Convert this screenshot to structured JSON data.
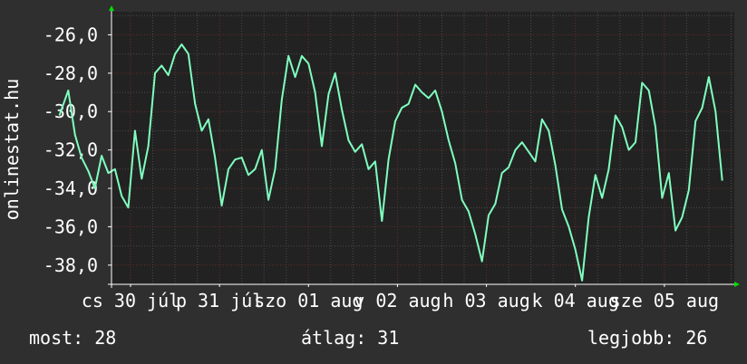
{
  "chart_data": {
    "type": "line",
    "watermark": "onlinestat.hu",
    "ylim": [
      -39,
      -24.8
    ],
    "yticks": [
      -26,
      -28,
      -30,
      -32,
      -34,
      -36,
      -38
    ],
    "ytick_labels": [
      "-26,0",
      "-28,0",
      "-30,0",
      "-32,0",
      "-34,0",
      "-36,0",
      "-38,0"
    ],
    "xlim": [
      0,
      28
    ],
    "xticks": [
      {
        "label": "cs 30 júl",
        "x": 0
      },
      {
        "label": "p 31 júl",
        "x": 4
      },
      {
        "label": "szo 01 aug",
        "x": 8
      },
      {
        "label": "v 02 aug",
        "x": 12
      },
      {
        "label": "h 03 aug",
        "x": 16
      },
      {
        "label": "k 04 aug",
        "x": 20
      },
      {
        "label": "sze 05 aug",
        "x": 24
      }
    ],
    "grid": true,
    "line_color": "#7fffbf",
    "series": [
      {
        "x": [
          -3.2,
          -2.8,
          -2.5,
          -2.2,
          -1.9,
          -1.6,
          -1.3,
          -1.0,
          -0.7,
          -0.4,
          -0.1,
          0.2,
          0.5,
          0.8,
          1.1,
          1.4,
          1.7,
          2.0,
          2.3,
          2.6,
          2.9,
          3.2,
          3.5,
          3.8,
          4.1,
          4.4,
          4.7,
          5.0,
          5.3,
          5.6,
          5.9,
          6.2,
          6.5,
          6.8,
          7.1,
          7.4,
          7.7,
          8.0,
          8.3,
          8.6,
          8.9,
          9.2,
          9.5,
          9.8,
          10.1,
          10.4,
          10.7,
          11.0,
          11.3,
          11.6,
          11.9,
          12.2,
          12.5,
          12.8,
          13.1,
          13.4,
          13.7,
          14.0,
          14.3,
          14.6,
          14.9,
          15.2,
          15.5,
          15.8,
          16.1,
          16.4,
          16.7,
          17.0,
          17.3,
          17.6,
          17.9,
          18.2,
          18.5,
          18.8,
          19.1,
          19.4,
          19.7,
          20.0,
          20.3,
          20.6,
          20.9,
          21.2,
          21.5,
          21.8,
          22.1,
          22.4,
          22.7,
          23.0,
          23.3,
          23.6,
          23.9,
          24.2,
          24.5,
          24.8,
          25.1,
          25.4,
          25.7,
          26.0,
          26.3,
          26.6
        ],
        "y": [
          -30.2,
          -28.9,
          -31.2,
          -32.4,
          -33.1,
          -34.0,
          -32.3,
          -33.2,
          -33.0,
          -34.4,
          -35.0,
          -31.0,
          -33.5,
          -31.8,
          -28.0,
          -27.6,
          -28.1,
          -27.0,
          -26.5,
          -27.0,
          -29.6,
          -31.0,
          -30.4,
          -32.4,
          -34.9,
          -33.0,
          -32.5,
          -32.4,
          -33.3,
          -33.0,
          -32.0,
          -34.6,
          -33.0,
          -29.4,
          -27.1,
          -28.2,
          -27.1,
          -27.5,
          -29.0,
          -31.8,
          -29.1,
          -28.0,
          -29.9,
          -31.5,
          -32.1,
          -31.7,
          -33.0,
          -32.6,
          -35.7,
          -32.5,
          -30.5,
          -29.8,
          -29.6,
          -28.6,
          -29.0,
          -29.3,
          -28.9,
          -30.0,
          -31.5,
          -32.7,
          -34.6,
          -35.2,
          -36.4,
          -37.8,
          -35.4,
          -34.8,
          -33.2,
          -32.9,
          -32.0,
          -31.6,
          -32.1,
          -32.6,
          -30.4,
          -31.0,
          -32.8,
          -35.1,
          -36.0,
          -37.2,
          -38.8,
          -35.5,
          -33.3,
          -34.5,
          -33.0,
          -30.2,
          -30.8,
          -32.0,
          -31.6,
          -28.5,
          -28.9,
          -30.8,
          -34.5,
          -33.2,
          -36.2,
          -35.5,
          -34.1,
          -30.5,
          -29.8,
          -28.2,
          -30.0,
          -33.6
        ]
      }
    ]
  },
  "footer": {
    "now": "most: 28",
    "avg": "átlag: 31",
    "best": "legjobb: 26"
  }
}
